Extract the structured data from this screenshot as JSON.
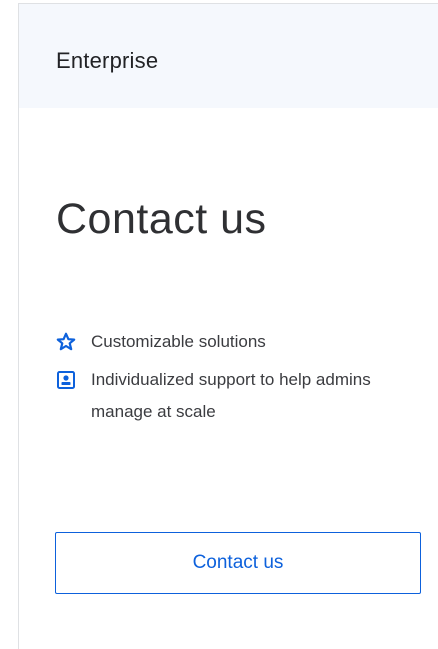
{
  "plan": {
    "tier_name": "Enterprise",
    "price_title": "Contact us",
    "features": [
      {
        "icon": "star-outline-icon",
        "label": "Customizable solutions"
      },
      {
        "icon": "support-badge-icon",
        "label": "Individualized support to help admins manage at scale"
      }
    ],
    "cta_label": "Contact us"
  },
  "colors": {
    "accent": "#0d61dc",
    "header_background": "#f5f8fd",
    "border": "#dfe1e4",
    "text_primary": "#222326"
  }
}
